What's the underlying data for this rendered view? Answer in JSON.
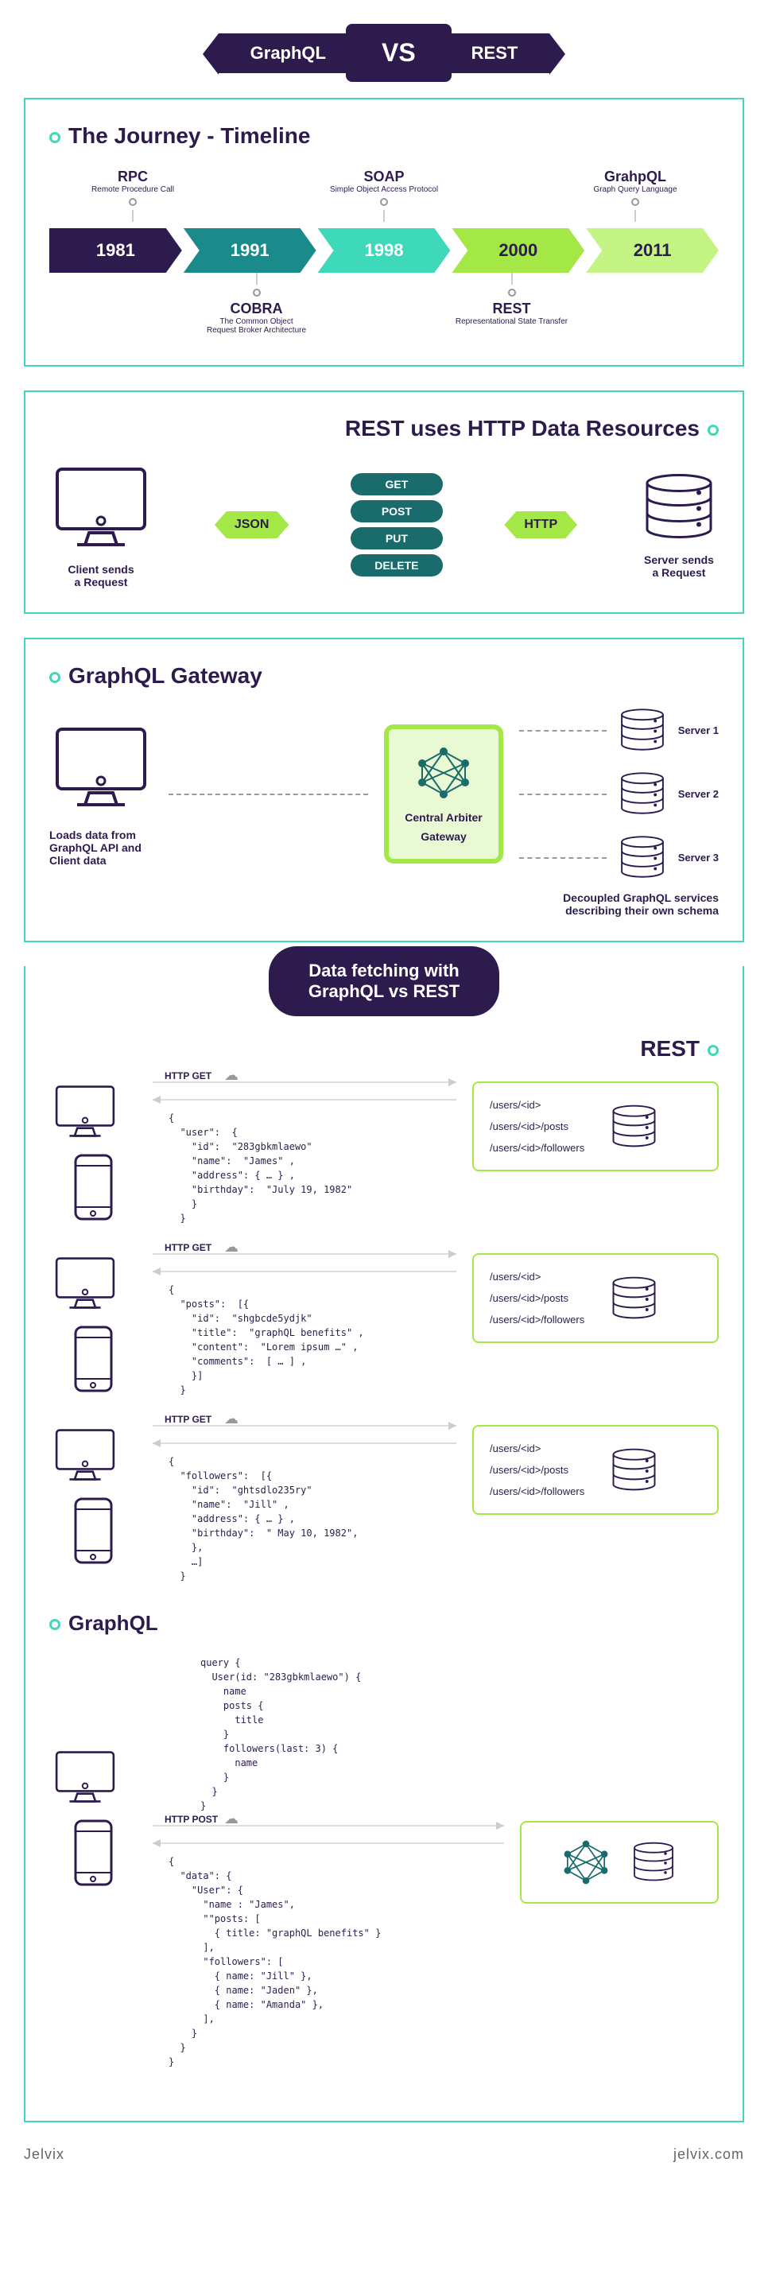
{
  "header": {
    "left": "GraphQL",
    "center": "VS",
    "right": "REST"
  },
  "timeline": {
    "title": "The Journey - Timeline",
    "top_labels": [
      {
        "name": "RPC",
        "sub": "Remote Procedure Call"
      },
      {
        "name": "SOAP",
        "sub": "Simple Object Access Protocol"
      },
      {
        "name": "GrahpQL",
        "sub": "Graph Query Language"
      }
    ],
    "years": [
      "1981",
      "1991",
      "1998",
      "2000",
      "2011"
    ],
    "bottom_labels": [
      {
        "name": "COBRA",
        "sub": "The Common Object\nRequest Broker Architecture"
      },
      {
        "name": "REST",
        "sub": "Representational State Transfer"
      }
    ]
  },
  "rest_http": {
    "title": "REST uses HTTP Data Resources",
    "json_label": "JSON",
    "http_label": "HTTP",
    "methods": [
      "GET",
      "POST",
      "PUT",
      "DELETE"
    ],
    "client_caption": "Client sends\na Request",
    "server_caption": "Server sends\na Request"
  },
  "gateway": {
    "title": "GraphQL Gateway",
    "arbiter_label": "Central Arbiter",
    "gateway_label": "Gateway",
    "servers": [
      "Server 1",
      "Server 2",
      "Server 3"
    ],
    "left_caption": "Loads data from\nGraphQL API and\nClient data",
    "right_caption": "Decoupled GraphQL services\ndescribing their own schema"
  },
  "fetching": {
    "header": "Data fetching with\nGraphQL vs REST",
    "rest_title": "REST",
    "graphql_title": "GraphQL",
    "http_get": "HTTP GET",
    "http_post": "HTTP POST",
    "endpoints": [
      "/users/<id>",
      "/users/<id>/posts",
      "/users/<id>/followers"
    ],
    "rest_code_1": "{\n  \"user\":  {\n    \"id\":  \"283gbkmlaewo\"\n    \"name\":  \"James\" ,\n    \"address\": { … } ,\n    \"birthday\":  \"July 19, 1982\"\n    }\n  }",
    "rest_code_2": "{\n  \"posts\":  [{\n    \"id\":  \"shgbcde5ydjk\"\n    \"title\":  \"graphQL benefits\" ,\n    \"content\":  \"Lorem ipsum …\" ,\n    \"comments\":  [ … ] ,\n    }]\n  }",
    "rest_code_3": "{\n  \"followers\":  [{\n    \"id\":  \"ghtsdlo235ry\"\n    \"name\":  \"Jill\" ,\n    \"address\": { … } ,\n    \"birthday\":  \" May 10, 1982\",\n    },\n    …]\n  }",
    "graphql_query": "query {\n  User(id: \"283gbkmlaewo\") {\n    name\n    posts {\n      title\n    }\n    followers(last: 3) {\n      name\n    }\n  }\n}",
    "graphql_response": "{\n  \"data\": {\n    \"User\": {\n      \"name : \"James\",\n      \"\"posts: [\n        { title: \"graphQL benefits\" }\n      ],\n      \"followers\": [\n        { name: \"Jill\" },\n        { name: \"Jaden\" },\n        { name: \"Amanda\" },\n      ],\n    }\n  }\n}"
  },
  "footer": {
    "left": "Jelvix",
    "right": "jelvix.com"
  }
}
